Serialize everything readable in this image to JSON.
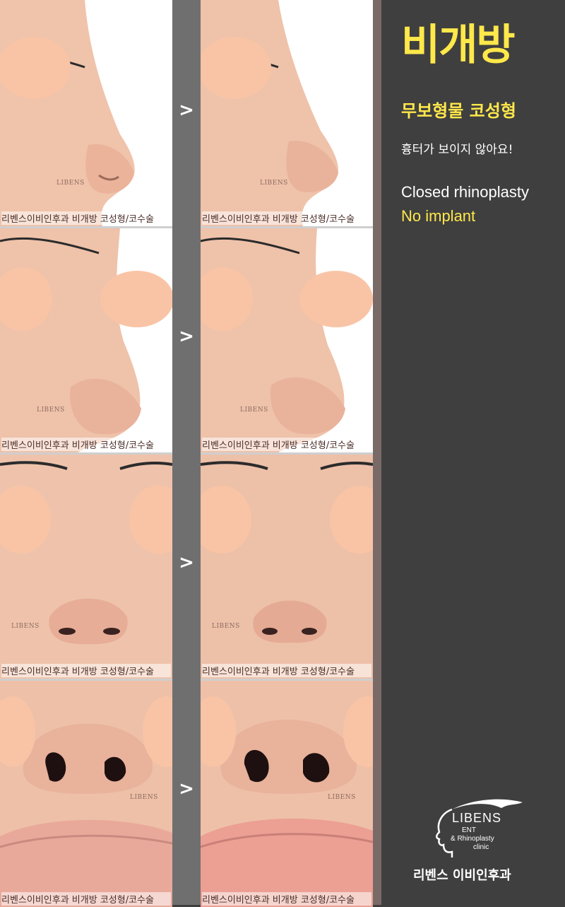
{
  "header": {
    "title": "비개방",
    "subtitle": "무보형물 코성형",
    "tagline": "흉터가 보이지 않아요!",
    "english_line1": "Closed rhinoplasty",
    "english_line2": "No implant"
  },
  "brand": {
    "logo_name": "LIBENS",
    "logo_sub1": "ENT",
    "logo_sub2": "& Rhinoplasty",
    "logo_sub3": "clinic",
    "clinic_name": "리벤스 이비인후과"
  },
  "photos": {
    "watermark_logo": "LIBENS",
    "watermark_bar": "리벤스이비인후과 비개방 코성형/코수술",
    "separator_arrow": ">",
    "rows": [
      {
        "view": "side-profile",
        "before_label": "before",
        "after_label": "after"
      },
      {
        "view": "three-quarter",
        "before_label": "before",
        "after_label": "after"
      },
      {
        "view": "front",
        "before_label": "before",
        "after_label": "after"
      },
      {
        "view": "base-view",
        "before_label": "before",
        "after_label": "after"
      }
    ]
  },
  "colors": {
    "accent_yellow": "#ffe84a",
    "sidebar_bg": "#3f3f3f",
    "separator_gray": "#6f6f6f",
    "border_brown": "#7a6a67",
    "skin": "#f0c8b2",
    "privacy_oval": "#f9c4a6"
  }
}
